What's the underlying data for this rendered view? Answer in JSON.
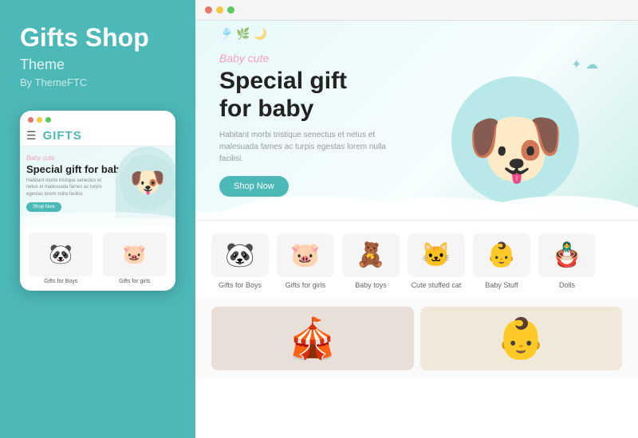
{
  "left": {
    "title": "Gifts Shop",
    "subtitle": "Theme",
    "author": "By ThemeFTC",
    "mobile": {
      "logo": "GIFTS",
      "hero_tag": "Baby cute",
      "hero_title": "Special gift for baby",
      "hero_desc": "Habitant morbi tristique senectus et netus et malesuada fames ac turpis egestas lorem nulla facilisi.",
      "hero_btn": "Shop Now",
      "products": [
        {
          "label": "Gifts for Boys",
          "emoji": "🐼"
        },
        {
          "label": "Gifts for girls",
          "emoji": "🐷"
        }
      ]
    }
  },
  "right": {
    "browser_dots": [
      "red",
      "yellow",
      "green"
    ],
    "hero": {
      "tag": "Baby cute",
      "title": "Special gift\nfor baby",
      "desc": "Habitant morbi tristique senectus et netus et malesuada fames ac turpis egestas lorem nulla facilisi.",
      "btn_label": "Shop Now"
    },
    "categories": [
      {
        "label": "Gifts for Boys",
        "emoji": "🐼"
      },
      {
        "label": "Gifts for girls",
        "emoji": "🐷"
      },
      {
        "label": "Baby toys",
        "emoji": "🧸"
      },
      {
        "label": "Cute stuffed cat",
        "emoji": "🐱"
      },
      {
        "label": "Baby Stuff",
        "emoji": "👶"
      },
      {
        "label": "Dolls",
        "emoji": "🪆"
      }
    ],
    "bottom_images": [
      {
        "emoji": "🎪",
        "alt": "play area"
      },
      {
        "emoji": "👶",
        "alt": "baby photo"
      }
    ]
  }
}
